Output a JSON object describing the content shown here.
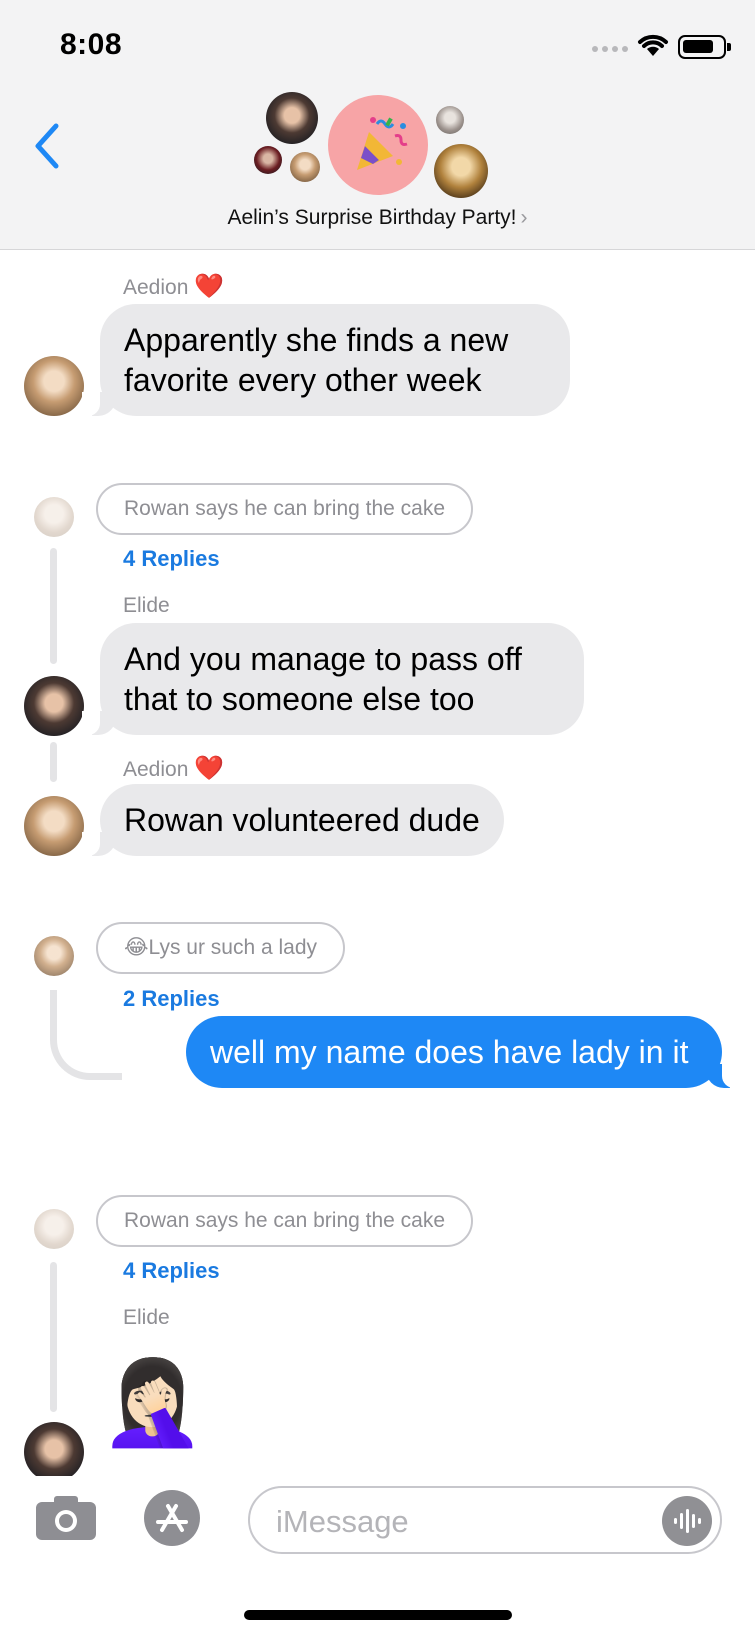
{
  "status_bar": {
    "time": "8:08"
  },
  "header": {
    "group_name": "Aelin’s Surprise Birthday Party!",
    "chevron": "›",
    "back_icon": "chevron-left-icon",
    "group_icon": "party-popper-icon"
  },
  "messages": [
    {
      "sender": "Aedion",
      "heart": "❤️",
      "text": "Apparently she finds a new favorite every other week"
    },
    {
      "quote": "Rowan says he can bring the cake",
      "replies": "4 Replies"
    },
    {
      "sender": "Elide",
      "text": "And you manage to pass off that to someone else too"
    },
    {
      "sender": "Aedion",
      "heart": "❤️",
      "text": "Rowan volunteered dude"
    },
    {
      "quote_emoji": "😂",
      "quote": "Lys ur such a lady",
      "replies": "2 Replies"
    },
    {
      "own": true,
      "text": "well my name does have lady in it"
    },
    {
      "quote": "Rowan says he can bring the cake",
      "replies": "4 Replies"
    },
    {
      "sender": "Elide",
      "emoji": "🤦🏻‍♀️"
    }
  ],
  "input": {
    "placeholder": "iMessage",
    "camera_icon": "camera-icon",
    "appstore_icon": "app-store-icon",
    "audio_icon": "audio-waveform-icon"
  },
  "colors": {
    "accent": "#1e88f5",
    "link": "#1a7ae0",
    "gray_bubble": "#e9e9eb",
    "header_bg": "#f3f3f4",
    "group_icon_bg": "#f7a4a6"
  }
}
